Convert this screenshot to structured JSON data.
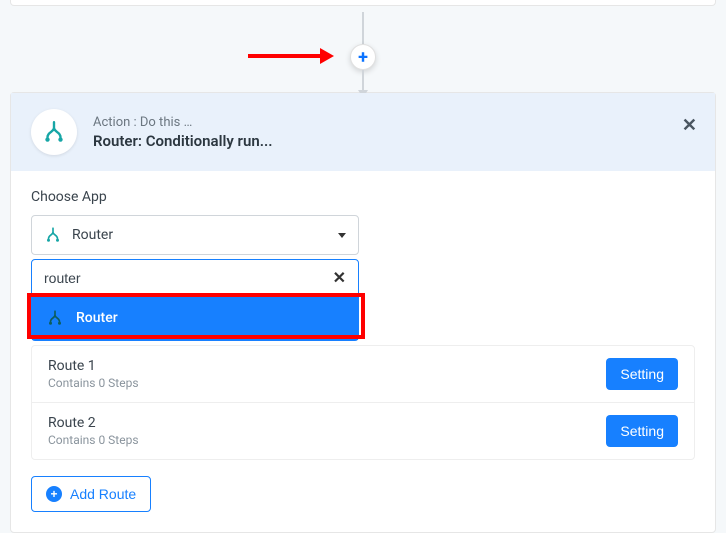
{
  "header": {
    "action_label": "Action : Do this …",
    "title": "Router: Conditionally run..."
  },
  "choose_app": {
    "label": "Choose App",
    "selected": "Router",
    "search_value": "router",
    "option": "Router"
  },
  "routes": [
    {
      "name": "Route 1",
      "steps": "Contains 0 Steps",
      "setting": "Setting"
    },
    {
      "name": "Route 2",
      "steps": "Contains 0 Steps",
      "setting": "Setting"
    }
  ],
  "add_route_label": "Add Route",
  "plus_label": "+"
}
